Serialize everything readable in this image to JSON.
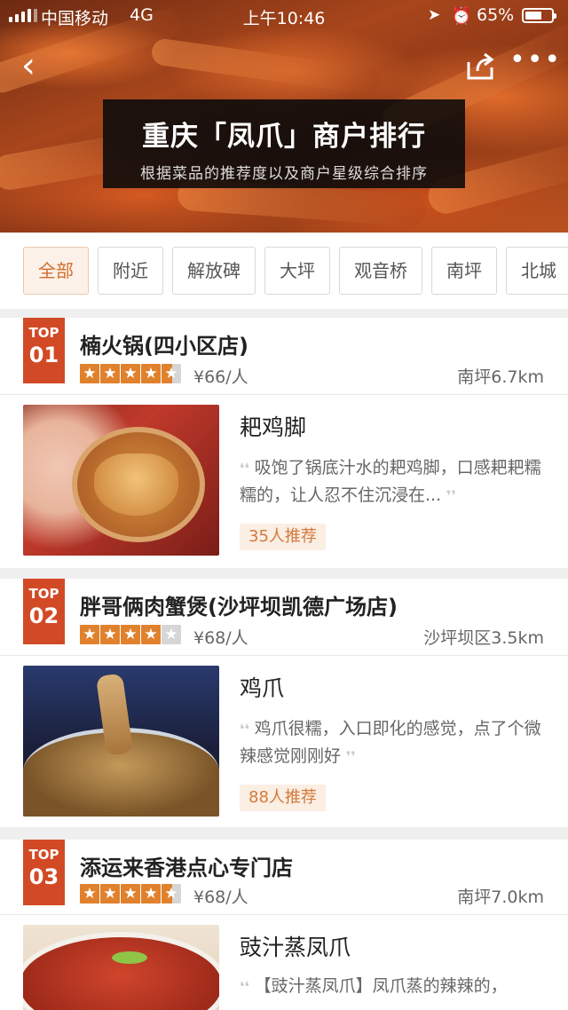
{
  "status_bar": {
    "carrier": "中国移动",
    "network": "4G",
    "time": "上午10:46",
    "battery": "65%",
    "battery_level": 0.65
  },
  "header": {
    "title": "重庆「凤爪」商户排行",
    "subtitle": "根据菜品的推荐度以及商户星级综合排序"
  },
  "icons": {
    "back": "chevron-left-icon",
    "share": "share-icon",
    "more": "more-icon"
  },
  "filters": [
    "全部",
    "附近",
    "解放碑",
    "大坪",
    "观音桥",
    "南坪",
    "北城"
  ],
  "active_filter": 0,
  "colors": {
    "accent": "#d24a25",
    "star": "#e0812d",
    "chip_active": "#d36d2c"
  },
  "shops": [
    {
      "top_label": "TOP",
      "rank": "01",
      "name": "楠火锅(四小区店)",
      "rating": 4.5,
      "price": "¥66/人",
      "distance": "南坪6.7km",
      "dish": "耙鸡脚",
      "quote": "吸饱了锅底汁水的耙鸡脚，口感耙耙糯糯的，让人忍不住沉浸在...",
      "recommend": "35人推荐"
    },
    {
      "top_label": "TOP",
      "rank": "02",
      "name": "胖哥俩肉蟹煲(沙坪坝凯德广场店)",
      "rating": 4,
      "price": "¥68/人",
      "distance": "沙坪坝区3.5km",
      "dish": "鸡爪",
      "quote": "鸡爪很糯，入口即化的感觉，点了个微辣感觉刚刚好",
      "recommend": "88人推荐"
    },
    {
      "top_label": "TOP",
      "rank": "03",
      "name": "添运来香港点心专门店",
      "rating": 4.5,
      "price": "¥68/人",
      "distance": "南坪7.0km",
      "dish": "豉汁蒸凤爪",
      "quote": "【豉汁蒸凤爪】凤爪蒸的辣辣的，",
      "recommend": ""
    }
  ]
}
